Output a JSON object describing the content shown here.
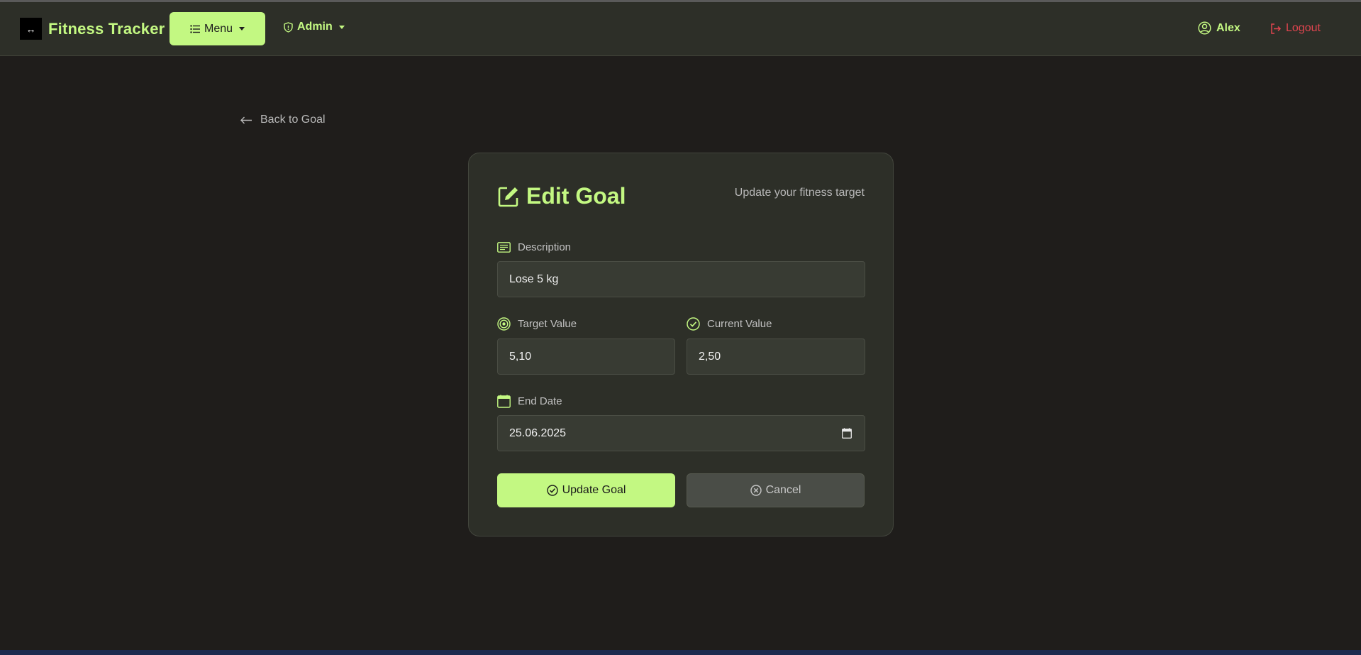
{
  "navbar": {
    "brand_logo_glyph": "↔",
    "brand_name": "Fitness Tracker",
    "menu_label": "Menu",
    "admin_label": "Admin",
    "user_name": "Alex",
    "logout_label": "Logout"
  },
  "back_link": {
    "label": "Back to Goal"
  },
  "card": {
    "title": "Edit Goal",
    "subtitle": "Update your fitness target"
  },
  "form": {
    "description": {
      "label": "Description",
      "value": "Lose 5 kg"
    },
    "target_value": {
      "label": "Target Value",
      "value": "5,10"
    },
    "current_value": {
      "label": "Current Value",
      "value": "2,50"
    },
    "end_date": {
      "label": "End Date",
      "value": "25.06.2025"
    }
  },
  "actions": {
    "update_label": "Update Goal",
    "cancel_label": "Cancel"
  },
  "colors": {
    "accent": "#c3f882",
    "background": "#1f1d1b",
    "surface": "#2d2f28",
    "input": "#383b33",
    "danger": "#e0454f"
  },
  "icons": {
    "menu": "list-icon",
    "admin": "shield-icon",
    "user": "user-circle-icon",
    "logout": "logout-icon",
    "back": "arrow-left-icon",
    "title": "edit-icon",
    "description": "text-lines-icon",
    "target": "target-icon",
    "current": "check-circle-icon",
    "end_date": "calendar-icon",
    "update": "check-circle-icon",
    "cancel": "x-circle-icon"
  }
}
